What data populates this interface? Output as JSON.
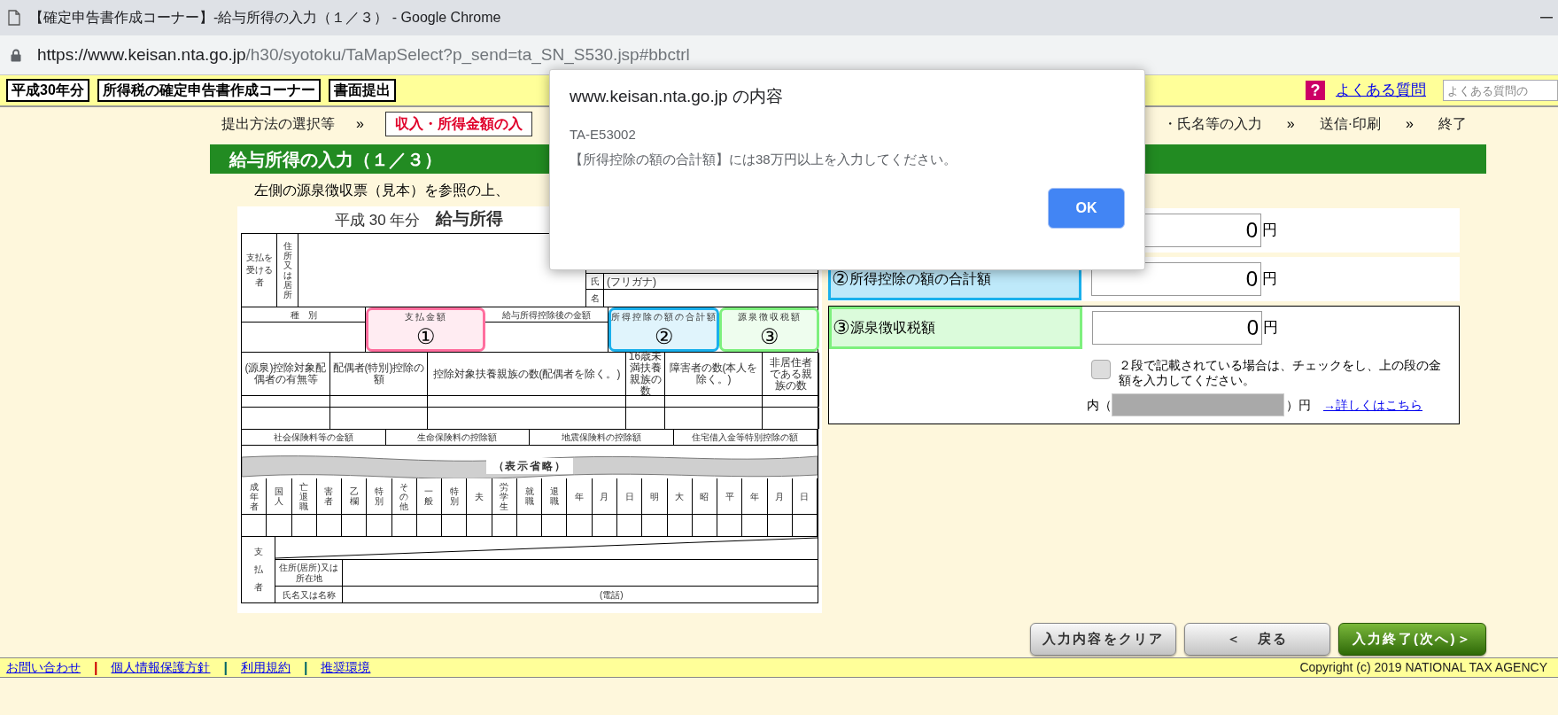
{
  "browser": {
    "title": "【確定申告書作成コーナー】-給与所得の入力（１／３） - Google Chrome",
    "url_host": "https://www.keisan.nta.go.jp",
    "url_path": "/h30/syotoku/TaMapSelect?p_send=ta_SN_S530.jsp#bbctrl"
  },
  "header": {
    "badges": [
      "平成30年分",
      "所得税の確定申告書作成コーナー",
      "書面提出"
    ],
    "help_icon": "?",
    "faq_link": "よくある質問",
    "search_placeholder": "よくある質問の"
  },
  "breadcrumb_left": [
    {
      "kind": "step",
      "text": "提出方法の選択等",
      "selected": false
    },
    {
      "kind": "separator",
      "text": "»"
    },
    {
      "kind": "step",
      "text": "収入・所得金額の入",
      "selected": true
    }
  ],
  "breadcrumb_right": [
    {
      "kind": "step",
      "text": "・氏名等の入力",
      "selected": false
    },
    {
      "kind": "separator",
      "text": "»"
    },
    {
      "kind": "step",
      "text": "送信·印刷",
      "selected": false
    },
    {
      "kind": "separator",
      "text": "»"
    },
    {
      "kind": "step",
      "text": "終了",
      "selected": false
    }
  ],
  "page_title": "給与所得の入力（１／３）",
  "instruction": "左側の源泉徴収票（見本）を参照の上、",
  "form_sample": {
    "title_year": "平成 30 年分",
    "title_name": "給与所得",
    "recipient_label": "支払を受ける者",
    "address_label": "住所又は居所",
    "name_label_1": "氏",
    "furigana_label": "(フリガナ)",
    "name_label_2": "名",
    "columns": [
      {
        "label": "種　別"
      },
      {
        "label": "支払金額",
        "marker": "①",
        "color": "#ff6e9e"
      },
      {
        "label": "給与所得控除後の金額"
      },
      {
        "label": "所得控除の額の合計額",
        "marker": "②",
        "color": "#1ab0ec"
      },
      {
        "label": "源泉徴収税額",
        "marker": "③",
        "color": "#7ef07e"
      }
    ],
    "dependents_headers": [
      "(源泉)控除対象配偶者の有無等",
      "配偶者(特別)控除の額",
      "控除対象扶養親族の数(配偶者を除く。)",
      "16歳未満扶養親族の数",
      "障害者の数(本人を除く。)",
      "非居住者である親族の数"
    ],
    "insurance_headers": [
      "社会保険料等の金額",
      "生命保険料の控除額",
      "地震保険料の控除額",
      "住宅借入金等特別控除の額"
    ],
    "omitted_label": "（表示省略）",
    "status_columns": [
      "成年者",
      "国人",
      "亡退職",
      "害者",
      "乙欄",
      "特別",
      "その他",
      "一般",
      "特別",
      "夫",
      "労学生",
      "就職",
      "退職",
      "年",
      "月",
      "日",
      "明",
      "大",
      "昭",
      "平",
      "年",
      "月",
      "日"
    ],
    "payer_label": "支払者",
    "payer_address_label": "住所(居所)又は所在地",
    "payer_name_label": "氏名又は名称",
    "phone_label": "(電話)"
  },
  "amount_rows": [
    {
      "value": "0",
      "unit": "円"
    },
    {
      "marker": "②",
      "label": "所得控除の額の合計額",
      "color": "#1ab0ec",
      "value": "0",
      "unit": "円"
    },
    {
      "marker": "③",
      "label": "源泉徴収税額",
      "color": "#7ef07e",
      "value": "0",
      "unit": "円"
    }
  ],
  "two_tier": {
    "checked": false,
    "text": "２段で記載されている場合は、チェックをし、上の段の金額を入力してください。",
    "prefix": "内（",
    "suffix": "）円",
    "disabled": true,
    "link": "→詳しくはこちら"
  },
  "buttons": [
    {
      "kind": "secondary",
      "label": "入力内容をクリア"
    },
    {
      "kind": "secondary",
      "label": "＜　戻る"
    },
    {
      "kind": "primary",
      "label": "入力終了(次へ)＞"
    }
  ],
  "footer": {
    "items": [
      {
        "kind": "link",
        "text": "お問い合わせ"
      },
      {
        "kind": "separator",
        "text": "|",
        "color": "#cc0000"
      },
      {
        "kind": "link",
        "text": "個人情報保護方針"
      },
      {
        "kind": "separator",
        "text": "|",
        "color": "#006666"
      },
      {
        "kind": "link",
        "text": "利用規約"
      },
      {
        "kind": "separator",
        "text": "|",
        "color": "#006666"
      },
      {
        "kind": "link",
        "text": "推奨環境"
      }
    ],
    "copyright": "Copyright (c) 2019 NATIONAL TAX AGENCY"
  },
  "dialog": {
    "title": "www.keisan.nta.go.jp の内容",
    "code": "TA-E53002",
    "message": "【所得控除の額の合計額】には38万円以上を入力してください。",
    "button": "OK"
  }
}
